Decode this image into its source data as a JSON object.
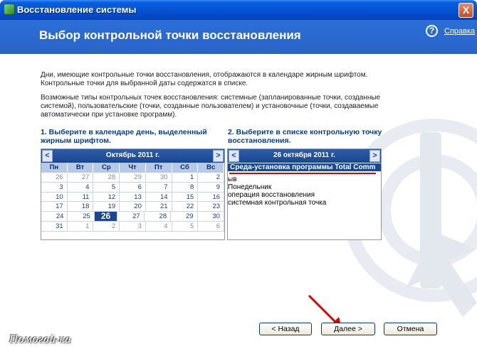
{
  "window": {
    "title": "Восстановление системы",
    "close_label": "X"
  },
  "header": {
    "title": "Выбор контрольной точки восстановления",
    "help_label": "Справка"
  },
  "description": {
    "line1": "Дни, имеющие контрольные точки восстановления, отображаются в календаре жирным шрифтом. Контрольные точки для выбранной даты содержатся в списке.",
    "line2": "Возможные типы контрольных точек восстановления: системные (запланированные точки, созданные системой), пользовательские (точки, созданные пользователем) и установочные (точки, создаваемые автоматически при установке программ)."
  },
  "step1": {
    "label": "1. Выберите в календаре день, выделенный жирным шрифтом."
  },
  "step2": {
    "label": "2. Выберите в списке контрольную точку восстановления."
  },
  "calendar": {
    "month_title": "Октябрь 2011 г.",
    "prev": "<",
    "next": ">",
    "weekdays": [
      "Пн",
      "Вт",
      "Ср",
      "Чт",
      "Пт",
      "Сб",
      "Вс"
    ],
    "weeks": [
      [
        "26",
        "27",
        "28",
        "29",
        "30",
        "1",
        "2"
      ],
      [
        "3",
        "4",
        "5",
        "6",
        "7",
        "8",
        "9"
      ],
      [
        "10",
        "11",
        "12",
        "13",
        "14",
        "15",
        "16"
      ],
      [
        "17",
        "18",
        "19",
        "20",
        "21",
        "22",
        "23"
      ],
      [
        "24",
        "25",
        "26",
        "27",
        "28",
        "29",
        "30"
      ],
      [
        "31",
        "1",
        "2",
        "3",
        "4",
        "5",
        "6"
      ]
    ],
    "selected": "26"
  },
  "restore_list": {
    "date_title": "26 октября 2011 г.",
    "prev": "<",
    "next": ">",
    "selected_item": "Среда-установка программы Total Comm",
    "items": [
      "ыв",
      "Понедельник",
      "операция восстановления",
      "системная контрольная точка"
    ]
  },
  "buttons": {
    "back": "< Назад",
    "next": "Далее >",
    "cancel": "Отмена"
  },
  "brand": "Помогай-ка",
  "colors": {
    "accent": "#1b4690",
    "header": "#2b64c8",
    "marker": "#dd0000"
  }
}
